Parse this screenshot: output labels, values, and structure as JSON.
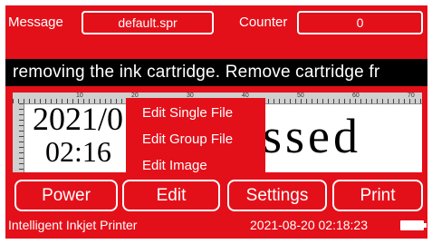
{
  "header": {
    "message_label": "Message",
    "message_value": "default.spr",
    "counter_label": "Counter",
    "counter_value": "0"
  },
  "ticker_text": "removing the ink cartridge. Remove cartridge fr",
  "preview": {
    "ruler_numbers": [
      "10",
      "20",
      "30",
      "40",
      "50",
      "60",
      "70"
    ],
    "date_line": "2021/0",
    "time_line": "02:16",
    "large_text": "ssed"
  },
  "edit_menu": {
    "items": [
      "Edit Single File",
      "Edit Group File",
      "Edit Image"
    ]
  },
  "buttons": {
    "power": "Power",
    "edit": "Edit",
    "settings": "Settings",
    "print": "Print"
  },
  "status": {
    "device_name": "Intelligent Inkjet Printer",
    "datetime": "2021-08-20  02:18:23"
  },
  "colors": {
    "background": "#e3101a",
    "ticker_background": "#000000",
    "foreground": "#ffffff"
  },
  "icons": [
    "battery-icon"
  ]
}
